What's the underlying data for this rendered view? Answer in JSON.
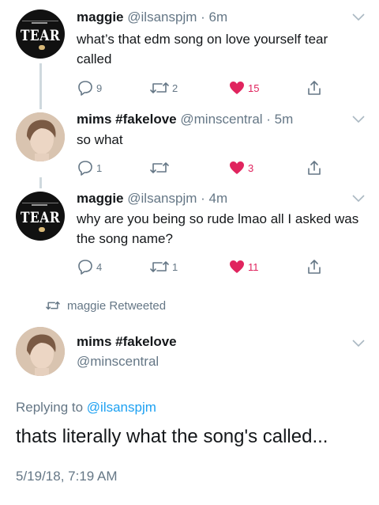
{
  "tweets": [
    {
      "name": "maggie",
      "handle": "@ilsanspjm",
      "time": "6m",
      "avatar_text": "TEAR",
      "text": "what’s that edm song on love yourself tear called",
      "replies": "9",
      "retweets": "2",
      "likes": "15"
    },
    {
      "name": "mims #fakelove",
      "handle": "@minscentral",
      "time": "5m",
      "text": "so what",
      "replies": "1",
      "retweets": "",
      "likes": "3"
    },
    {
      "name": "maggie",
      "handle": "@ilsanspjm",
      "time": "4m",
      "avatar_text": "TEAR",
      "text": "why are you being so rude lmao all I asked was the song name?",
      "replies": "4",
      "retweets": "1",
      "likes": "11"
    }
  ],
  "retweet_banner": "maggie Retweeted",
  "main_tweet": {
    "name": "mims #fakelove",
    "handle": "@minscentral",
    "replying_prefix": "Replying to ",
    "replying_to": "@ilsanspjm",
    "text": "thats literally what the song's called...",
    "timestamp": "5/19/18, 7:19 AM"
  },
  "meta_separator": " · ",
  "colors": {
    "text": "#14171a",
    "secondary": "#657786",
    "like": "#e0245e",
    "link": "#1da1f2",
    "thread_line": "#cfd9de"
  }
}
